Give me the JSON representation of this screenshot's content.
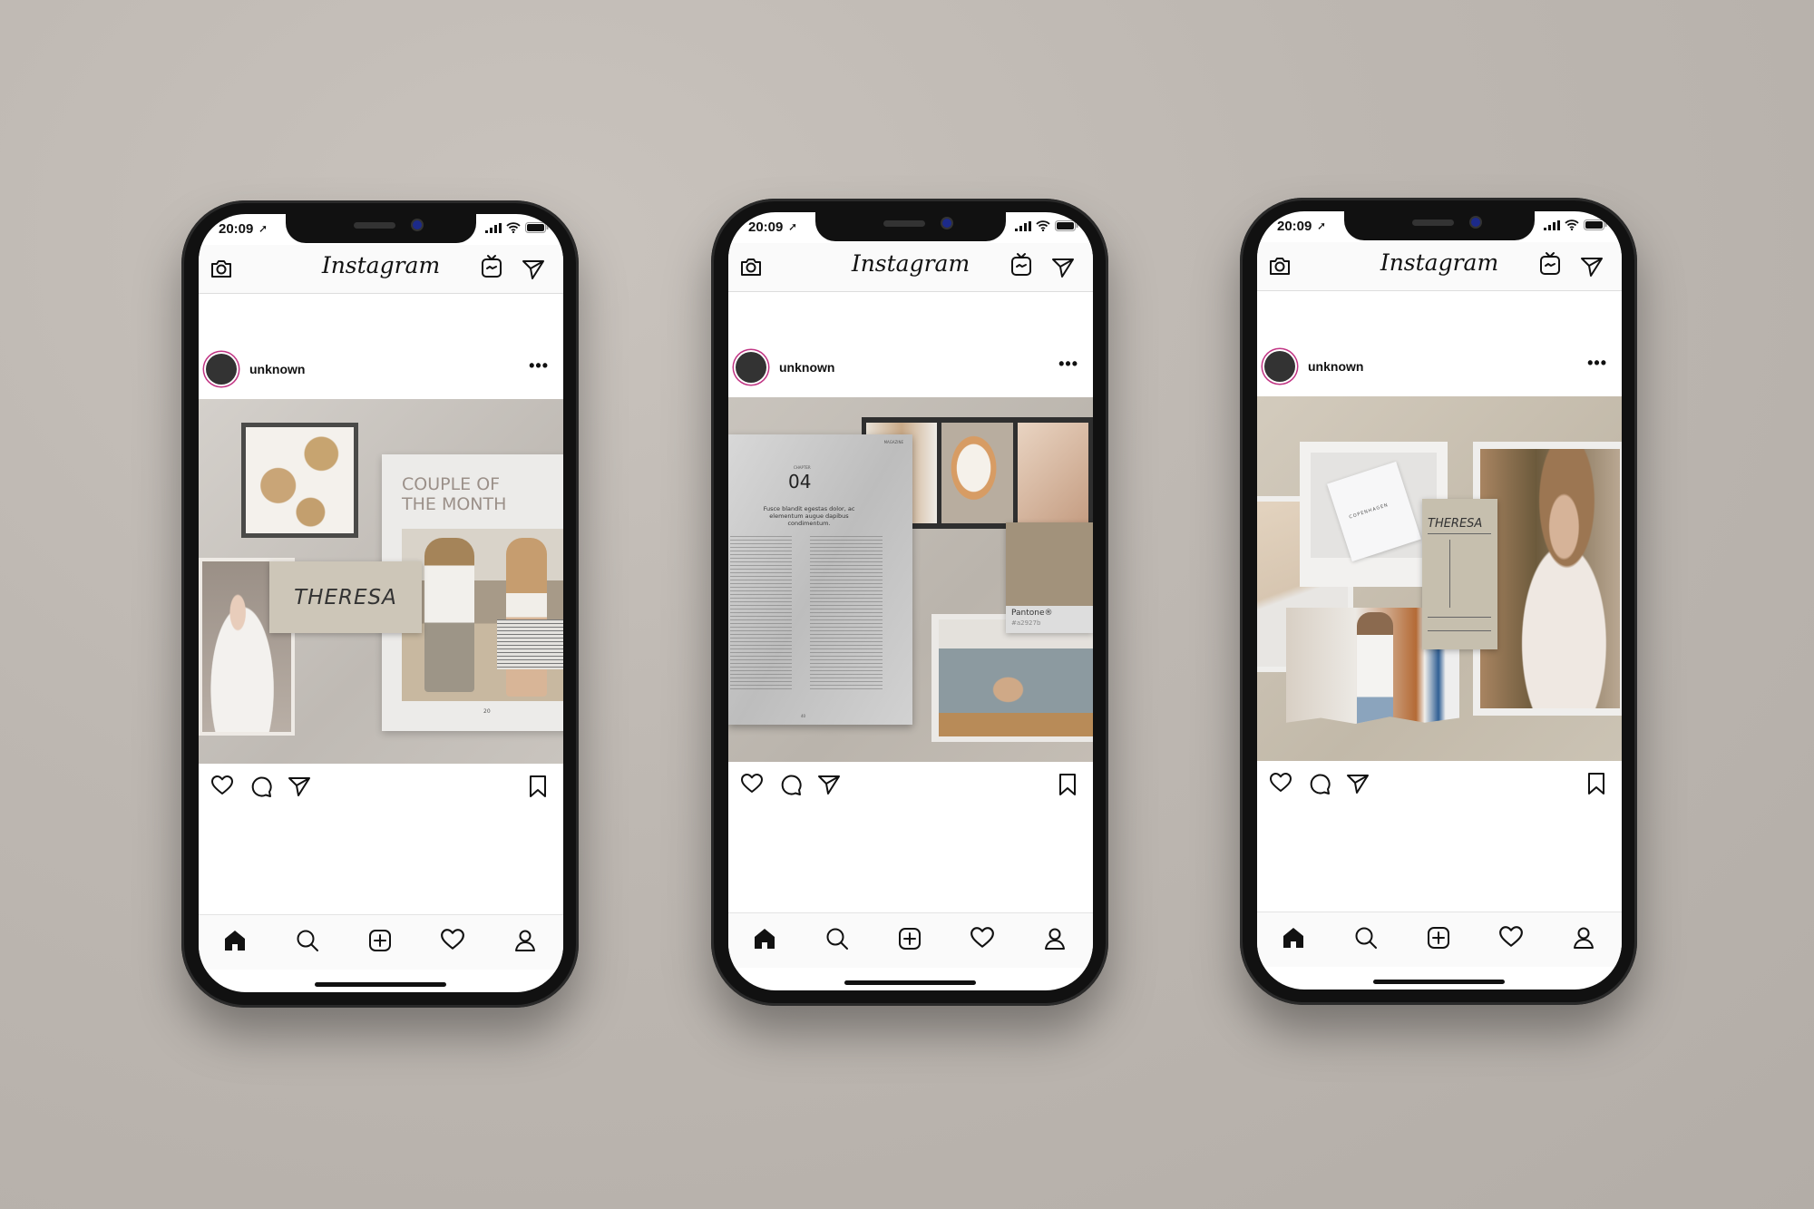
{
  "colors": {
    "background": "#bdb7b1",
    "phone_frame": "#111111",
    "story_ring": "#c13584",
    "card_beige": "#cdc6b8"
  },
  "phones": [
    {
      "status_time": "20:09",
      "app_title": "Instagram",
      "username": "unknown",
      "more_label": "•••",
      "post": {
        "card_title": "THERESA",
        "page_heading_1": "COUPLE OF",
        "page_heading_2": "THE MONTH",
        "page_number": "20"
      }
    },
    {
      "status_time": "20:09",
      "app_title": "Instagram",
      "username": "unknown",
      "more_label": "•••",
      "post": {
        "tag": "MAGAZINE",
        "chapter_label": "CHAPTER",
        "chapter_number": "04",
        "subtitle": "Fusce blandit egestas dolor, ac elementum augue dapibus condimentum.",
        "swatch_name": "Pantone®",
        "swatch_code": "#a2927b",
        "page_number": "40"
      }
    },
    {
      "status_time": "20:09",
      "app_title": "Instagram",
      "username": "unknown",
      "more_label": "•••",
      "post": {
        "card_title": "THERESA",
        "notebook_label": "COPENHAGEN"
      }
    }
  ],
  "icons": {
    "header": [
      "camera-icon",
      "igtv-icon",
      "direct-message-icon"
    ],
    "actions": [
      "heart-icon",
      "comment-icon",
      "share-icon",
      "bookmark-icon"
    ],
    "nav": [
      "home-icon",
      "search-icon",
      "add-post-icon",
      "activity-heart-icon",
      "profile-icon"
    ]
  }
}
